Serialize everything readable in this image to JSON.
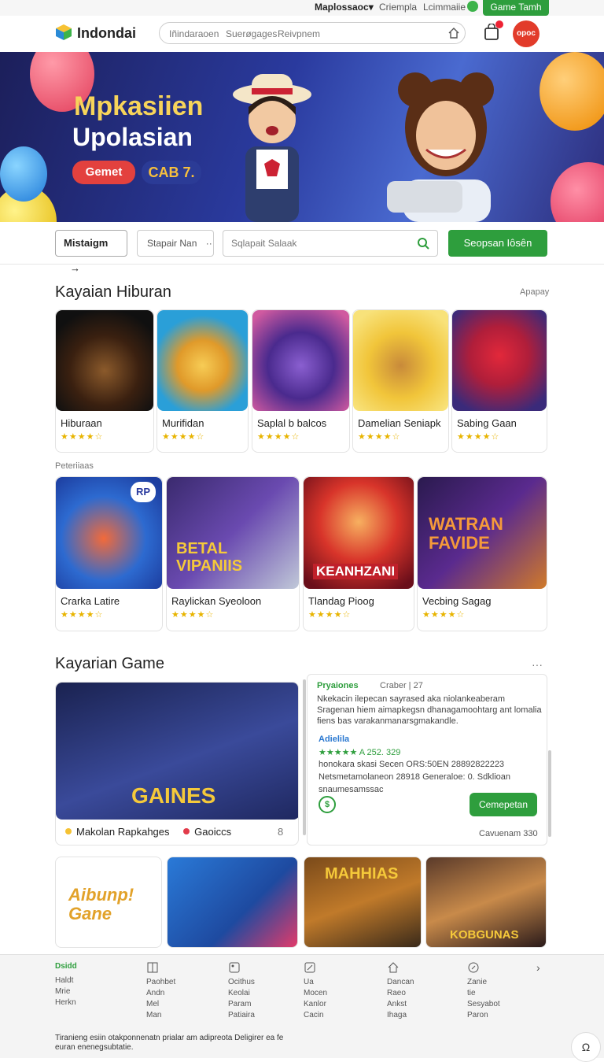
{
  "topbar": {
    "account": "Maplossaoc▾",
    "link1": "Criempla",
    "link2": "Lcimmaiie",
    "game_button": "Game Tamh"
  },
  "header": {
    "logo": "Indondai",
    "search_items": [
      "Iñindaraoen",
      "Suerøgages",
      "Reivpnem"
    ],
    "avatar": "opoc"
  },
  "hero": {
    "title_line1": "Mpkasiien",
    "title_line2": "Upolasian",
    "pill1": "Gemet",
    "pill2": "CAB 7."
  },
  "filters": {
    "dropdown1": "Mistaigm",
    "dropdown2": "Stapair Nan",
    "search_placeholder": "Sqlapait Salaak",
    "go_button": "Seopsan Iôsên"
  },
  "section1": {
    "title": "Kayaian Hiburan",
    "more": "Apapay",
    "cards": [
      {
        "name": "Hiburaan",
        "rating": "★★★★☆"
      },
      {
        "name": "Murifidan",
        "rating": "★★★★☆"
      },
      {
        "name": "Saplal b balcos",
        "rating": "★★★★☆"
      },
      {
        "name": "Damelian Seniapk",
        "rating": "★★★★☆"
      },
      {
        "name": "Sabing Gaan",
        "rating": "★★★★☆"
      }
    ]
  },
  "section2": {
    "label": "Peteriiaas",
    "cards": [
      {
        "name": "Crarka Latire",
        "rating": "★★★★☆",
        "badge": "RP"
      },
      {
        "name": "Raylickan Syeoloon",
        "rating": "★★★★☆",
        "art_text": "BETAL VIPANIIS"
      },
      {
        "name": "Tlandag Pioog",
        "rating": "★★★★☆",
        "art_text": "KEANHZANI"
      },
      {
        "name": "Vecbing Sagag",
        "rating": "★★★★☆",
        "art_text": "WATRAN FAVIDE"
      }
    ]
  },
  "section3": {
    "title": "Kayarian Game",
    "more": "···",
    "featured": {
      "art_text": "GAINES",
      "tag1": "Makolan Rapkahges",
      "tag2": "Gaoiccs",
      "count": "8"
    },
    "info": {
      "title": "Pryaiones",
      "title_meta": "Craber | 27",
      "description": "Nkekacin ilepecan sayrased aka niolankeaberam Sragenan hiem aimapkegsn dhanagamoohtarg ant lomalia fiens bas varakanmanarsgmakandle.",
      "sub": "Adielila",
      "row1": "★★★★★ A 252. 329",
      "row2": "honokara skasi Secen  ORS:50EN 28892822223",
      "row3": "Netsmetamolaneon  28918 Generaloe:  0. Sdklioan",
      "row4": "snaumesamssac",
      "circle": "$",
      "button": "Cemepetan",
      "count": "Cavuenam 330"
    },
    "tiles": [
      "Aibunp! Gane",
      "",
      "MAHHIAS",
      "KOBGUNAS"
    ]
  },
  "bottom_nav": [
    {
      "lines": [
        "Haldt",
        "Mrie",
        "Herkn"
      ],
      "top": "Dsidd"
    },
    {
      "lines": [
        "Paohbet",
        "Andn",
        "Mel",
        "Man"
      ]
    },
    {
      "lines": [
        "Ocithus",
        "Keolai",
        "Param",
        "Patiaira"
      ]
    },
    {
      "lines": [
        "Ua",
        "Mocen",
        "Kanlor",
        "Cacin"
      ]
    },
    {
      "lines": [
        "Dancan",
        "Raeo",
        "Ankst",
        "Ihaga"
      ]
    },
    {
      "lines": [
        "Zanie",
        "tie",
        "Sesyabot",
        "Paron"
      ]
    }
  ],
  "footer_text": "Tiranieng esiin otakponnenatn prialar am adipreota Deligirer ea fe euran enenegsubtatie.",
  "fab": "Ω",
  "colors": {
    "accent": "#2e9e3d",
    "red": "#e3413e",
    "star": "#e8b400"
  }
}
